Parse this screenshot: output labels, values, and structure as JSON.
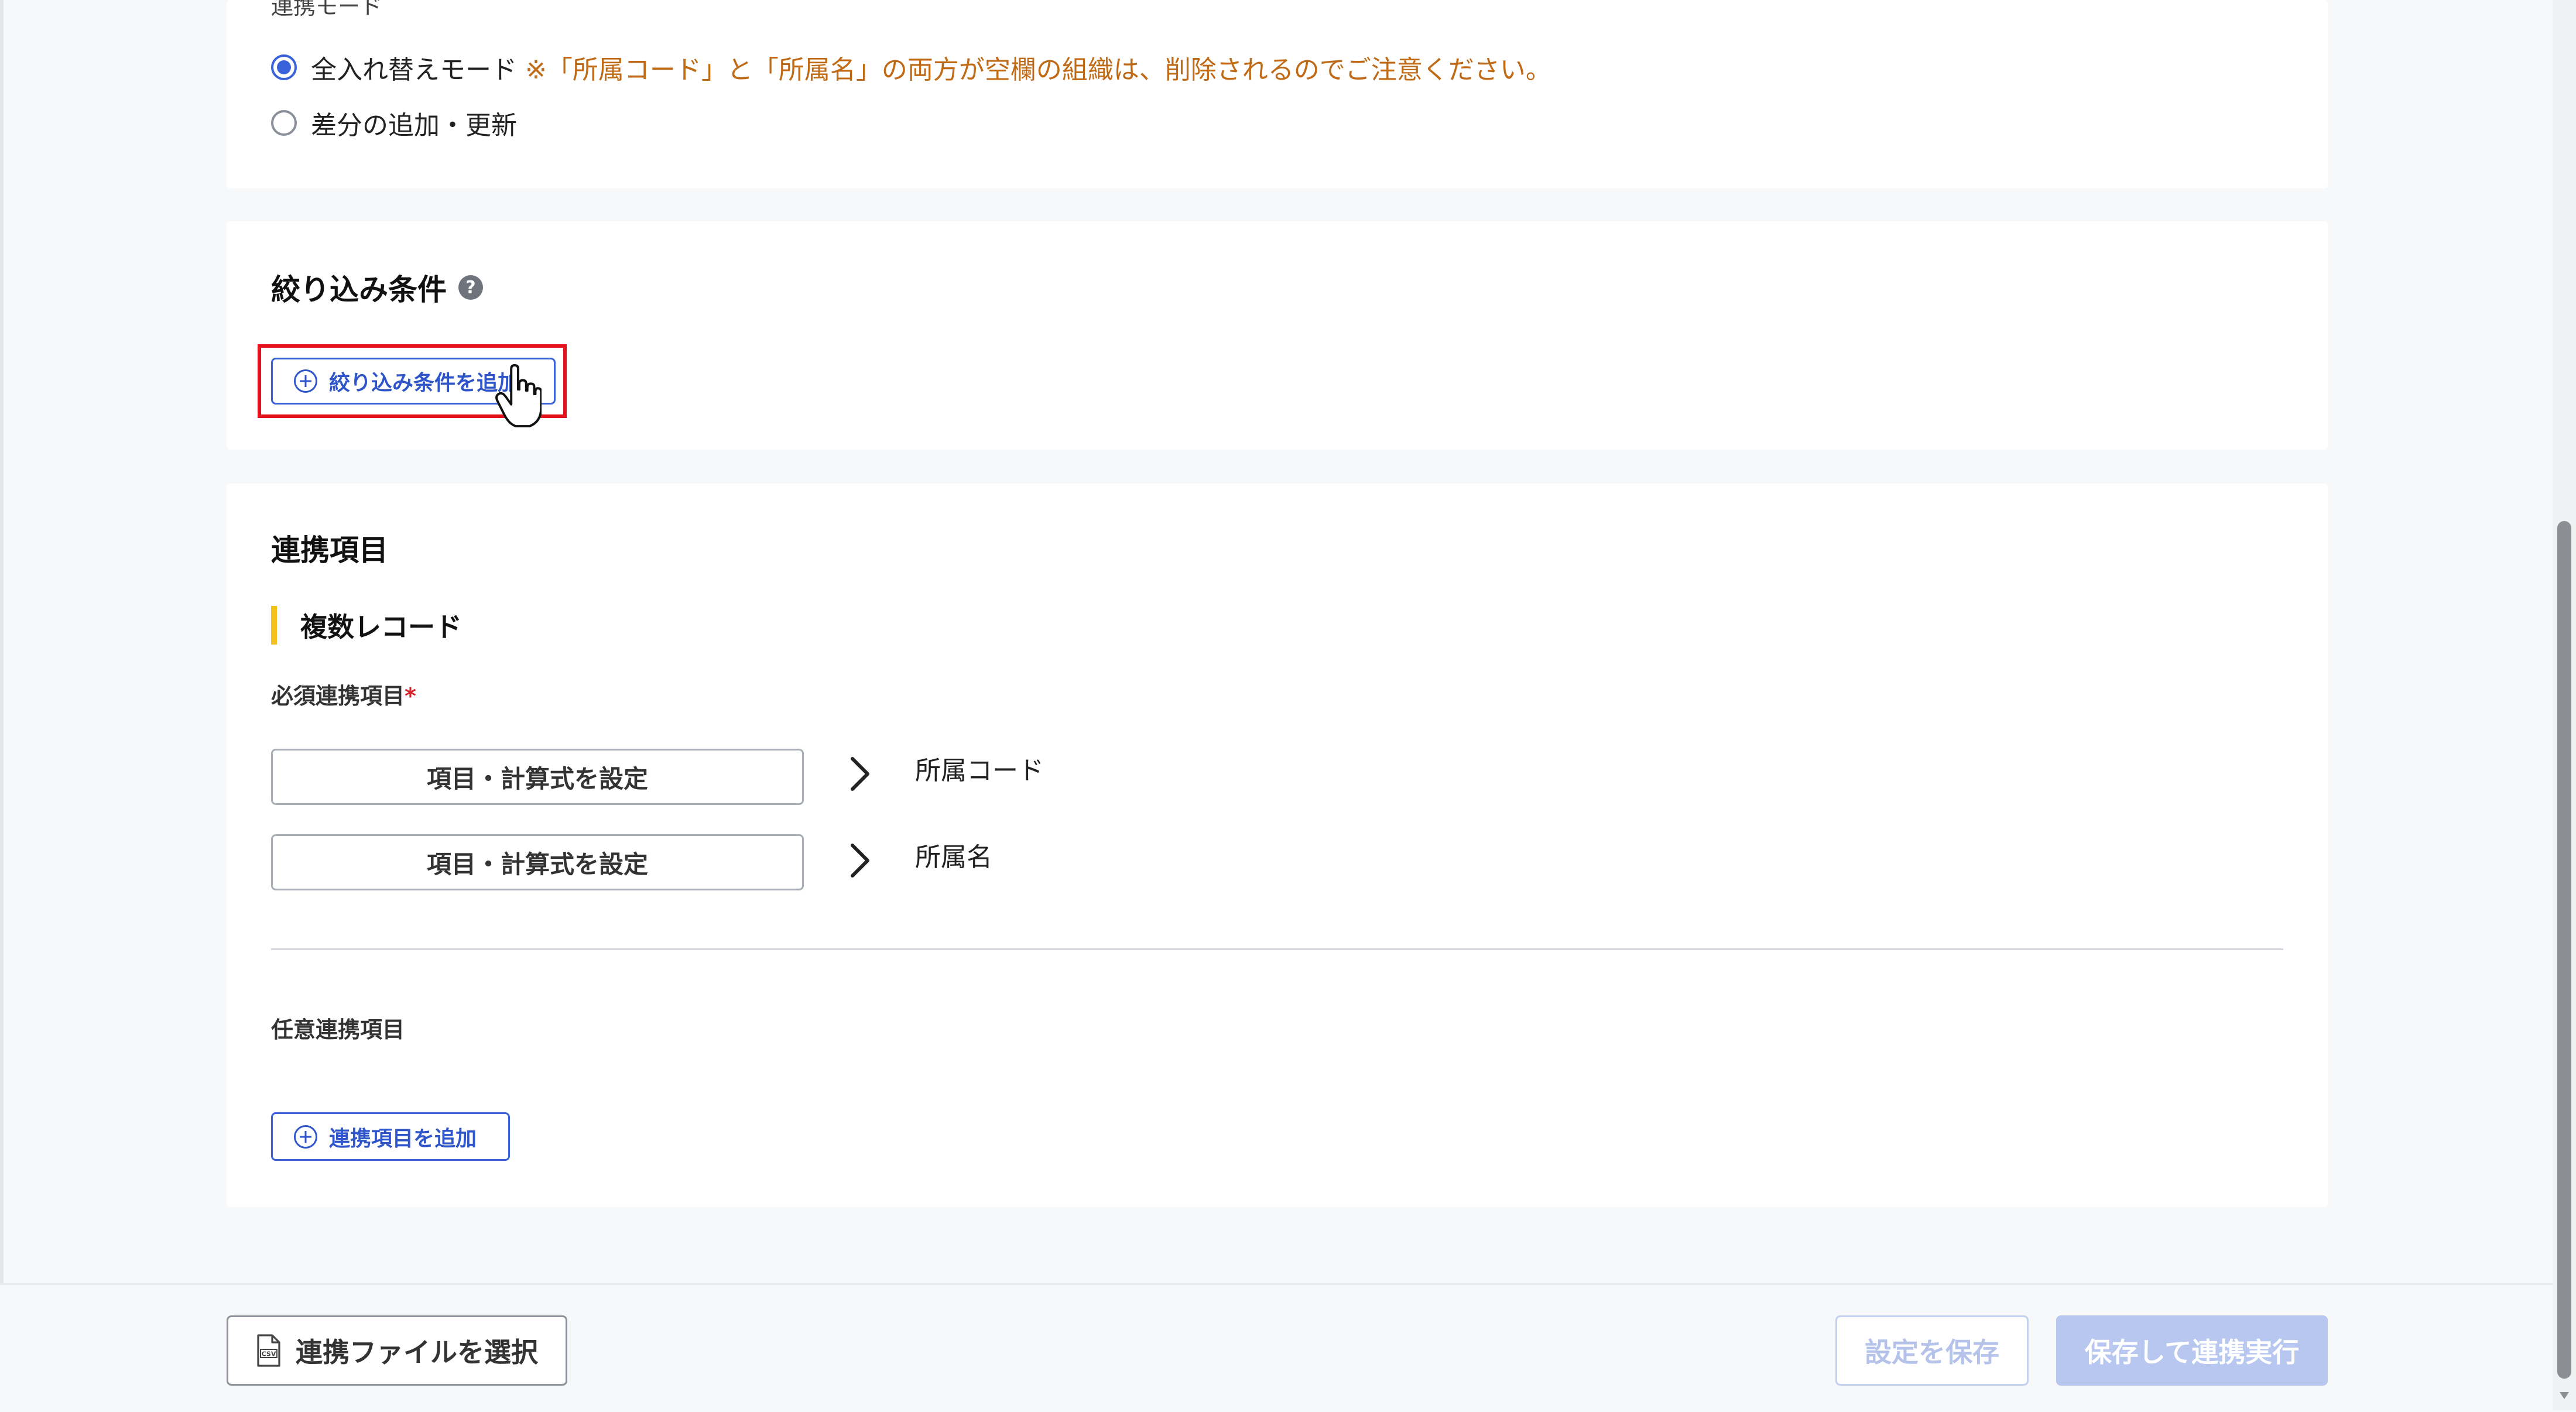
{
  "sync_mode": {
    "label": "連携モード",
    "options": [
      {
        "label": "全入れ替えモード",
        "note": "※「所属コード」と「所属名」の両方が空欄の組織は、削除されるのでご注意ください。",
        "checked": true
      },
      {
        "label": "差分の追加・更新",
        "note": "",
        "checked": false
      }
    ]
  },
  "filter": {
    "title": "絞り込み条件",
    "help_glyph": "?",
    "add_button": "絞り込み条件を追加"
  },
  "items": {
    "title": "連携項目",
    "subsection": "複数レコード",
    "required_label": "必須連携項目",
    "required_mark": "*",
    "rows": [
      {
        "button": "項目・計算式を設定",
        "target": "所属コード"
      },
      {
        "button": "項目・計算式を設定",
        "target": "所属名"
      }
    ],
    "optional_label": "任意連携項目",
    "add_item_button": "連携項目を追加"
  },
  "footer": {
    "select_file_button": "連携ファイルを選択",
    "save_button": "設定を保存",
    "save_and_run_button": "保存して連携実行"
  },
  "colors": {
    "accent": "#3a62d8",
    "warning_text": "#c06a16",
    "highlight": "#e3121b",
    "subsection_bar": "#f3c21a",
    "disabled_primary": "#b7c7ef"
  }
}
